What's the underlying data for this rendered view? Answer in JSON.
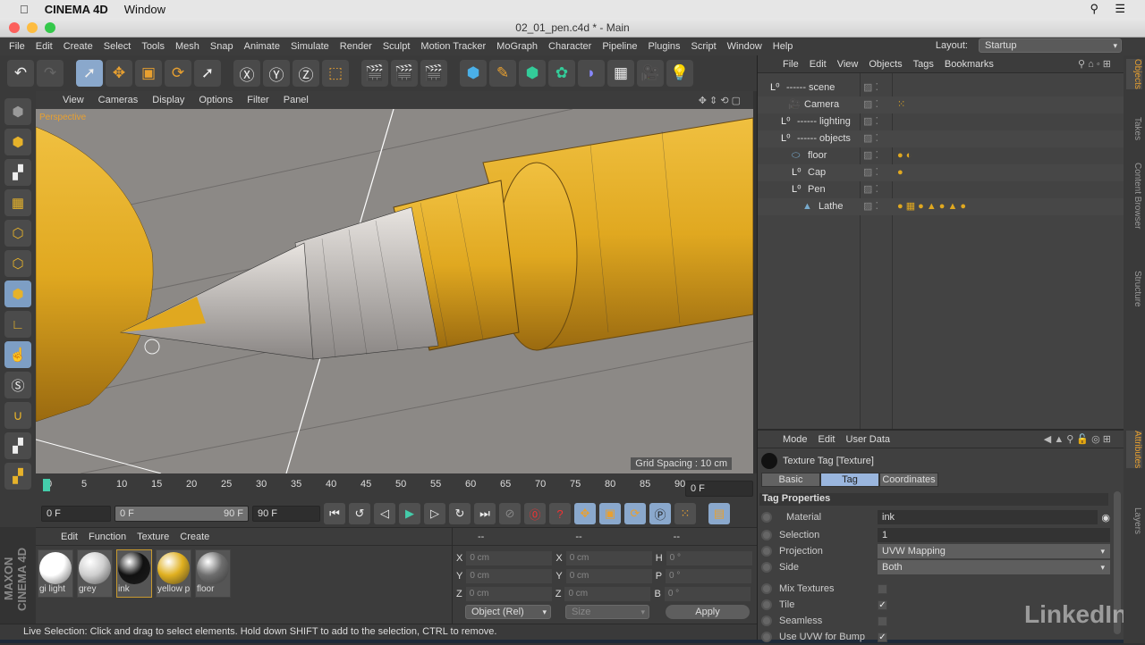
{
  "mac_menu": {
    "app": "CINEMA 4D",
    "items": [
      "Window"
    ]
  },
  "window_title": "02_01_pen.c4d * - Main",
  "menu": [
    "File",
    "Edit",
    "Create",
    "Select",
    "Tools",
    "Mesh",
    "Snap",
    "Animate",
    "Simulate",
    "Render",
    "Sculpt",
    "Motion Tracker",
    "MoGraph",
    "Character",
    "Pipeline",
    "Plugins",
    "Script",
    "Window",
    "Help"
  ],
  "layout": {
    "label": "Layout:",
    "value": "Startup"
  },
  "viewport": {
    "menu": [
      "View",
      "Cameras",
      "Display",
      "Options",
      "Filter",
      "Panel"
    ],
    "label": "Perspective",
    "grid_spacing": "Grid Spacing : 10 cm"
  },
  "timeline": {
    "ticks": [
      "0",
      "5",
      "10",
      "15",
      "20",
      "25",
      "30",
      "35",
      "40",
      "45",
      "50",
      "55",
      "60",
      "65",
      "70",
      "75",
      "80",
      "85",
      "90"
    ],
    "current": "0 F",
    "start": "0 F",
    "range_start": "0 F",
    "range_end": "90 F",
    "end": "90 F"
  },
  "material_manager": {
    "menu": [
      "Create",
      "Edit",
      "Function",
      "Texture"
    ],
    "materials": [
      {
        "name": "gi light",
        "color": "#ffffff"
      },
      {
        "name": "grey",
        "color": "#cfcfcf"
      },
      {
        "name": "ink",
        "color": "#111111"
      },
      {
        "name": "yellow p",
        "color": "#e0b020"
      },
      {
        "name": "floor",
        "color": "#6e6e6e"
      }
    ]
  },
  "coordinates": {
    "headers": [
      "--",
      "--",
      "--"
    ],
    "rows": [
      [
        "X",
        "0 cm",
        "X",
        "0 cm",
        "H",
        "0 °"
      ],
      [
        "Y",
        "0 cm",
        "Y",
        "0 cm",
        "P",
        "0 °"
      ],
      [
        "Z",
        "0 cm",
        "Z",
        "0 cm",
        "B",
        "0 °"
      ]
    ],
    "mode": "Object (Rel)",
    "size": "Size",
    "apply": "Apply"
  },
  "status": "Live Selection: Click and drag to select elements. Hold down SHIFT to add to the selection, CTRL to remove.",
  "object_manager": {
    "menu": [
      "File",
      "Edit",
      "View",
      "Objects",
      "Tags",
      "Bookmarks"
    ],
    "objects": [
      "------ scene",
      "Camera",
      "------ lighting",
      "------ objects",
      "floor",
      "Cap",
      "Pen",
      "Lathe"
    ]
  },
  "attributes": {
    "menu": [
      "Mode",
      "Edit",
      "User Data"
    ],
    "title": "Texture Tag [Texture]",
    "tabs": [
      "Basic",
      "Tag",
      "Coordinates"
    ],
    "section": "Tag Properties",
    "material": {
      "label": "Material",
      "value": "ink"
    },
    "selection": {
      "label": "Selection",
      "value": "1"
    },
    "projection": {
      "label": "Projection",
      "value": "UVW Mapping"
    },
    "side": {
      "label": "Side",
      "value": "Both"
    },
    "mix_textures": {
      "label": "Mix Textures",
      "checked": false
    },
    "tile": {
      "label": "Tile",
      "checked": true
    },
    "seamless": {
      "label": "Seamless",
      "checked": false
    },
    "use_uvw_bump": {
      "label": "Use UVW for Bump",
      "checked": true
    }
  },
  "side_tabs": [
    "Objects",
    "Takes",
    "Content Browser",
    "Structure",
    "Attributes",
    "Layers"
  ],
  "watermark": "LinkedIn",
  "logo": "MAXON CINEMA 4D",
  "colors": {
    "accent": "#8aa8cc",
    "yellow": "#e0a820",
    "active_tab": "#e8a030"
  }
}
